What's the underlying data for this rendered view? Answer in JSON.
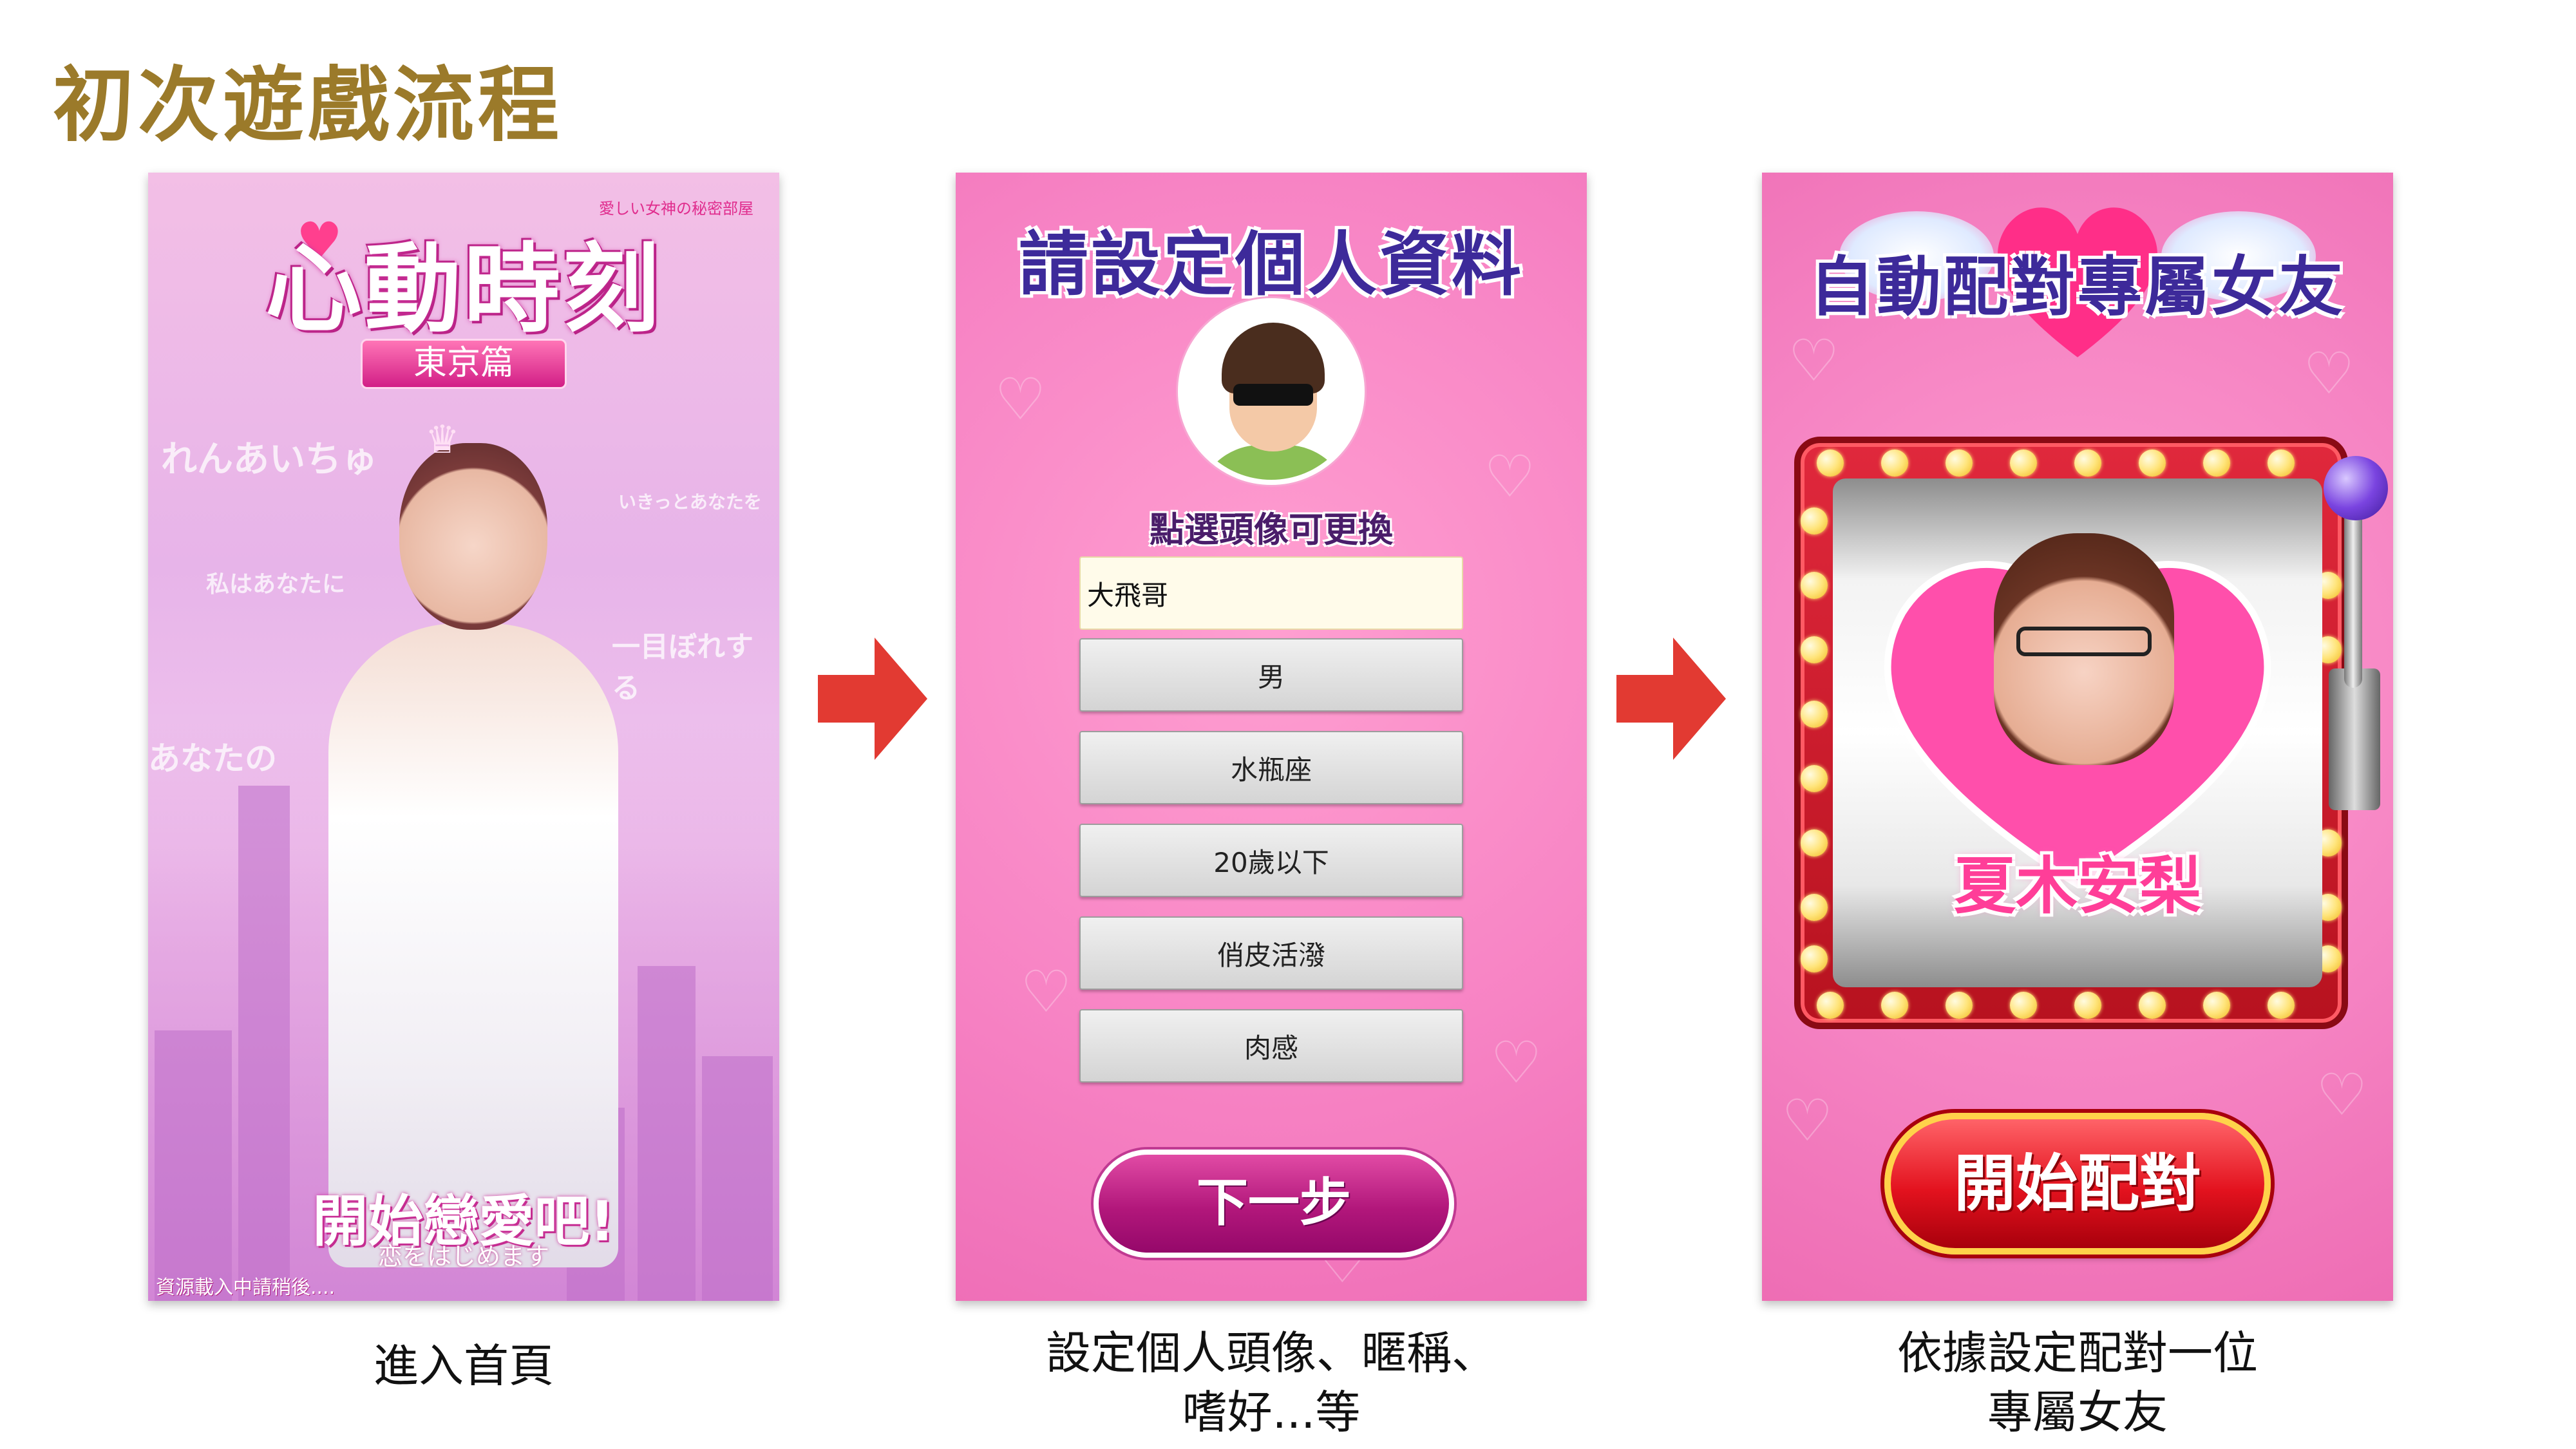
{
  "slide": {
    "title": "初次遊戲流程"
  },
  "screen1": {
    "logo_tagline": "愛しい女神の秘密部屋",
    "logo_title": "心動時刻",
    "logo_subtitle": "東京篇",
    "bg_texts": [
      "れんあいちゅ",
      "私はあなたに",
      "あなたの",
      "一目ぼれする",
      "いきっとあなたを"
    ],
    "cta_label": "開始戀愛吧!",
    "cta_sub": "恋をはじめます",
    "loading_text": "資源載入中請稍後....",
    "caption": "進入首頁"
  },
  "screen2": {
    "title": "請設定個人資料",
    "avatar_hint": "點選頭像可更換",
    "nickname_value": "大飛哥",
    "select_options": [
      "男",
      "水瓶座",
      "20歲以下",
      "俏皮活潑",
      "肉感"
    ],
    "next_button": "下一步",
    "caption_line1": "設定個人頭像、暱稱、",
    "caption_line2": "嗜好...等"
  },
  "screen3": {
    "title": "自動配對專屬女友",
    "matched_name": "夏木安梨",
    "start_button": "開始配對",
    "caption_line1": "依據設定配對一位",
    "caption_line2": "專屬女友"
  },
  "colors": {
    "title_gold": "#9b7a2a",
    "arrow_red": "#e23a32",
    "pink": "#f783c4",
    "deep_purple": "#3d2a9a"
  },
  "icons": [
    "arrow-right-icon",
    "heart-icon",
    "avatar-icon",
    "tiara-icon",
    "lever-icon"
  ]
}
